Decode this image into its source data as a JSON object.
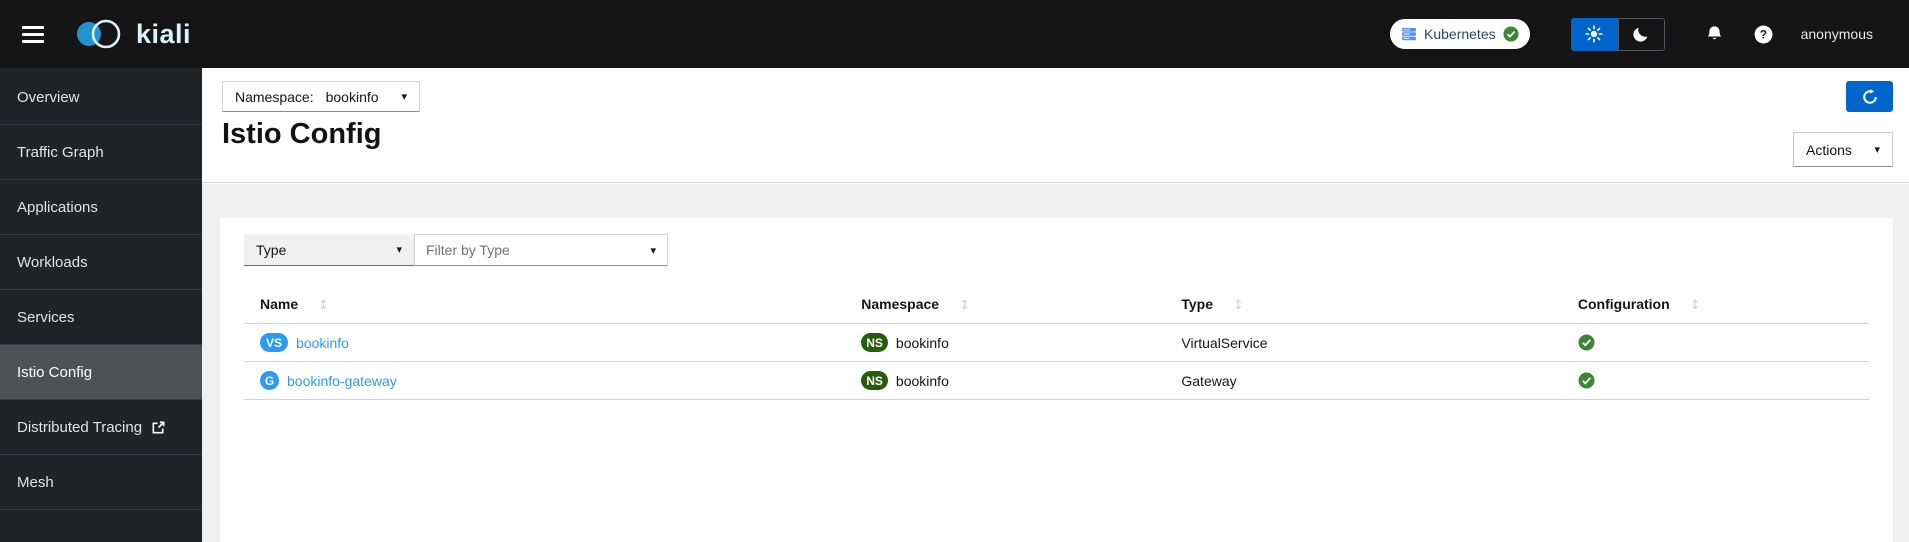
{
  "masthead": {
    "brand": "kiali",
    "kubernetes_badge": "Kubernetes",
    "user": "anonymous"
  },
  "sidebar": {
    "items": [
      {
        "label": "Overview",
        "active": false
      },
      {
        "label": "Traffic Graph",
        "active": false
      },
      {
        "label": "Applications",
        "active": false
      },
      {
        "label": "Workloads",
        "active": false
      },
      {
        "label": "Services",
        "active": false
      },
      {
        "label": "Istio Config",
        "active": true
      },
      {
        "label": "Distributed Tracing",
        "active": false,
        "external": true
      },
      {
        "label": "Mesh",
        "active": false
      }
    ]
  },
  "header": {
    "namespace_label": "Namespace:",
    "namespace_value": "bookinfo",
    "title": "Istio Config",
    "actions_label": "Actions"
  },
  "toolbar": {
    "type_label": "Type",
    "filter_placeholder": "Filter by Type"
  },
  "table": {
    "columns": [
      "Name",
      "Namespace",
      "Type",
      "Configuration"
    ],
    "rows": [
      {
        "badge": "VS",
        "name": "bookinfo",
        "namespace_badge": "NS",
        "namespace": "bookinfo",
        "type": "VirtualService",
        "configuration": "valid"
      },
      {
        "badge": "G",
        "name": "bookinfo-gateway",
        "namespace_badge": "NS",
        "namespace": "bookinfo",
        "type": "Gateway",
        "configuration": "valid"
      }
    ]
  },
  "icons": {
    "caret_down": "▾",
    "sort_both": "↕"
  },
  "colors": {
    "masthead_bg": "#151515",
    "sidebar_bg": "#212427",
    "sidebar_active_bg": "#4f5255",
    "page_bg": "#f0f0f0",
    "accent_blue": "#0066cc",
    "link_blue": "#2b9af3",
    "badge_blue": "#2b9af3",
    "namespace_badge_green": "#265c0c",
    "valid_green": "#3e8635",
    "border_gray": "#d2d2d2"
  }
}
